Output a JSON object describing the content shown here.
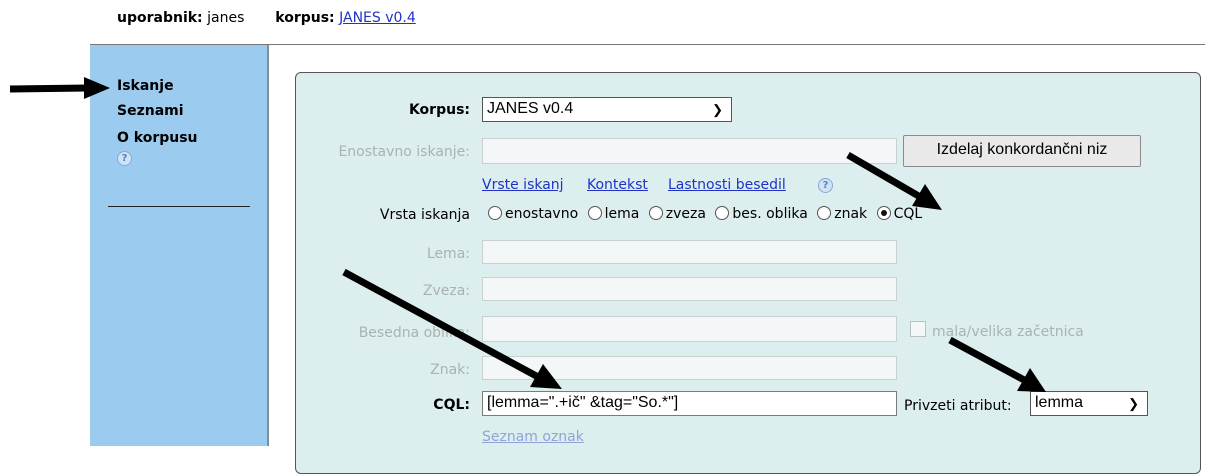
{
  "header": {
    "user_label": "uporabnik:",
    "user_value": "janes",
    "corpus_label": "korpus:",
    "corpus_link": "JANES v0.4"
  },
  "sidebar": {
    "items": [
      {
        "label": "Iskanje"
      },
      {
        "label": "Seznami"
      },
      {
        "label": "O korpusu"
      }
    ],
    "help_glyph": "?"
  },
  "form": {
    "corpus_label": "Korpus:",
    "corpus_value": "JANES v0.4",
    "simple_search_label": "Enostavno iskanje:",
    "concordance_button": "Izdelaj konkordančni niz",
    "links": [
      "Vrste iskanj",
      "Kontekst",
      "Lastnosti besedil"
    ],
    "help_glyph": "?",
    "search_type_label": "Vrsta iskanja",
    "search_types": [
      "enostavno",
      "lema",
      "zveza",
      "bes. oblika",
      "znak",
      "CQL"
    ],
    "selected_search_type": "CQL",
    "lemma_label": "Lema:",
    "phrase_label": "Zveza:",
    "wordform_label": "Besedna oblika:",
    "case_label": "mala/velika začetnica",
    "char_label": "Znak:",
    "cql_label": "CQL:",
    "cql_value": "[lemma=\".+ič\" &tag=\"So.*\"]",
    "default_attr_label": "Privzeti atribut:",
    "default_attr_value": "lemma",
    "tags_link": "Seznam oznak"
  },
  "colors": {
    "sidebar_bg": "#9ccbf0",
    "panel_bg": "#ddeeee",
    "link": "#1f33c8",
    "arrow": "#000000"
  }
}
